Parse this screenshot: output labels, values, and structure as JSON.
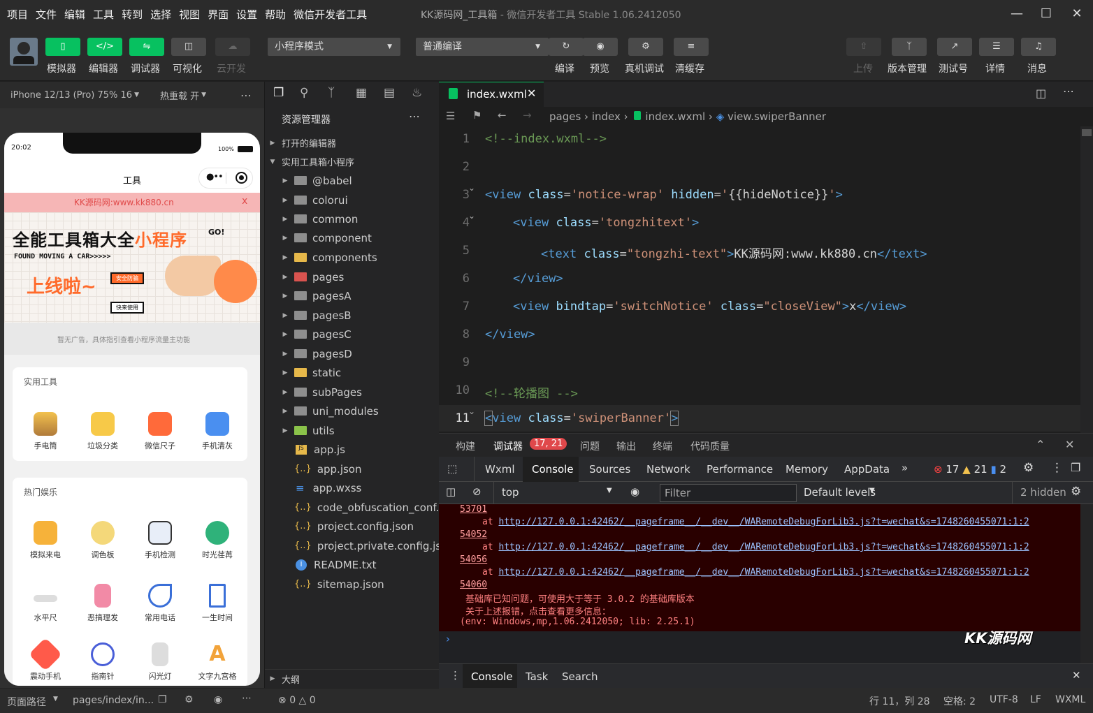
{
  "menu": [
    "项目",
    "文件",
    "编辑",
    "工具",
    "转到",
    "选择",
    "视图",
    "界面",
    "设置",
    "帮助",
    "微信开发者工具"
  ],
  "window_title": "KK源码网_工具箱",
  "window_subtitle": "- 微信开发者工具 Stable 1.06.2412050",
  "toolbar": {
    "left_buttons": [
      "模拟器",
      "编辑器",
      "调试器",
      "可视化",
      "云开发"
    ],
    "mode_select": "小程序模式",
    "compile_select": "普通编译",
    "mid_buttons": [
      "编译",
      "预览",
      "真机调试",
      "清缓存"
    ],
    "right_buttons": [
      "上传",
      "版本管理",
      "测试号",
      "详情",
      "消息"
    ]
  },
  "simulator": {
    "device": "iPhone 12/13 (Pro) 75% 16",
    "hotreload": "热重载 开",
    "time": "20:02",
    "battery": "100%",
    "nav_title": "工具",
    "notice": "KK源码网:www.kk880.cn",
    "notice_close": "x",
    "banner_title": "全能工具箱大全",
    "banner_title_accent": "小程序",
    "banner_sub": "FOUND MOVING A CAR>>>>>",
    "banner_launch": "上线啦~",
    "banner_go": "GO!",
    "banner_tag1": "安全防骗",
    "banner_tag2": "快来使用",
    "ad_text": "暂无广告，具体指引查看小程序流量主功能",
    "section1_title": "实用工具",
    "section1_items": [
      "手电筒",
      "垃圾分类",
      "微信尺子",
      "手机清灰"
    ],
    "section2_title": "热门娱乐",
    "section2_items_row1": [
      "模拟来电",
      "调色板",
      "手机检测",
      "时光荏苒"
    ],
    "section2_items_row2": [
      "水平尺",
      "恶搞理发",
      "常用电话",
      "一生时间"
    ],
    "section2_items_row3": [
      "震动手机",
      "指南针",
      "闪光灯",
      "文字九宫格"
    ]
  },
  "status_left": {
    "path_label": "页面路径",
    "path": "pages/index/in...",
    "errors": "0",
    "warnings": "0"
  },
  "explorer": {
    "title": "资源管理器",
    "open_editors": "打开的编辑器",
    "project": "实用工具箱小程序",
    "folders": [
      "@babel",
      "colorui",
      "common",
      "component",
      "components",
      "pages",
      "pagesA",
      "pagesB",
      "pagesC",
      "pagesD",
      "static",
      "subPages",
      "uni_modules",
      "utils"
    ],
    "files": [
      "app.js",
      "app.json",
      "app.wxss",
      "code_obfuscation_conf...",
      "project.config.json",
      "project.private.config.js...",
      "README.txt",
      "sitemap.json"
    ],
    "outline": "大纲"
  },
  "editor": {
    "tab": "index.wxml",
    "breadcrumb": [
      "pages",
      "index",
      "index.wxml",
      "view.swiperBanner"
    ],
    "line_numbers": [
      "1",
      "2",
      "3",
      "4",
      "5",
      "6",
      "7",
      "8",
      "9",
      "10",
      "11"
    ]
  },
  "devtools": {
    "top_tabs": [
      "构建",
      "调试器",
      "问题",
      "输出",
      "终端",
      "代码质量"
    ],
    "badge": "17, 21",
    "tabs": [
      "Wxml",
      "Console",
      "Sources",
      "Network",
      "Performance",
      "Memory",
      "AppData"
    ],
    "err_count": "17",
    "warn_count": "21",
    "info_count": "2",
    "context": "top",
    "filter_placeholder": "Filter",
    "levels": "Default levels",
    "hidden": "2 hidden",
    "console_lines": {
      "l1": "53701",
      "l2_at": "at",
      "l2_url": "http://127.0.0.1:42462/__pageframe__/__dev__/WARemoteDebugForLib3.js?t=wechat&s=1748260455071:1:2",
      "l3": "54052",
      "l5": "54056",
      "l7": "54060",
      "msg1": "基础库已知问题，可使用大于等于 3.0.2 的基础库版本",
      "msg2": "关于上述报错，点击查看更多信息：",
      "msg3": "(env: Windows,mp,1.06.2412050; lib: 2.25.1)"
    },
    "drawer_tabs": [
      "Console",
      "Task",
      "Search"
    ],
    "watermark": "KK源码网"
  },
  "status_right": {
    "pos": "行 11，列 28",
    "spaces": "空格: 2",
    "enc": "UTF-8",
    "eol": "LF",
    "lang": "WXML"
  }
}
